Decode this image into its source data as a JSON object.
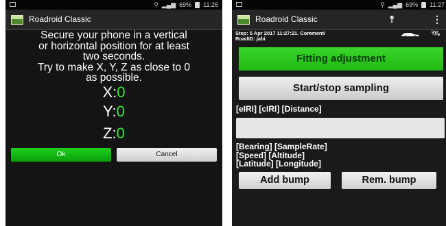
{
  "left_phone": {
    "status": {
      "battery": "69%",
      "time": "11:26"
    },
    "app_title": "Roadroid Classic",
    "instruction": [
      "Secure your phone in a vertical",
      "or horizontal position for at least",
      "two seconds.",
      "Try to make X, Y, Z as close to 0",
      "as possible."
    ],
    "axes": [
      {
        "label": "X:",
        "value": "0"
      },
      {
        "label": "Y:",
        "value": "0"
      },
      {
        "label": "Z:",
        "value": "0"
      }
    ],
    "ok_label": "Ok",
    "cancel_label": "Cancel"
  },
  "right_phone": {
    "status": {
      "battery": "69%",
      "time": "11:27"
    },
    "app_title": "Roadroid Classic",
    "meta_line1": "Step: 5 Apr 2017 11:27:21. Comment/",
    "meta_line2": "RoadID: jabi",
    "fitting_label": "Fitting adjustment",
    "sampling_label": "Start/stop sampling",
    "iri_label": "[eIRI] [cIRI] [Distance]",
    "info_lines": [
      "[Bearing] [SampleRate]",
      "[Speed] [Altitude]",
      "[Latitude] [Longitude]"
    ],
    "add_bump_label": "Add bump",
    "rem_bump_label": "Rem. bump"
  },
  "colors": {
    "accent_green": "#22b814",
    "value_green": "#3ae63a"
  }
}
